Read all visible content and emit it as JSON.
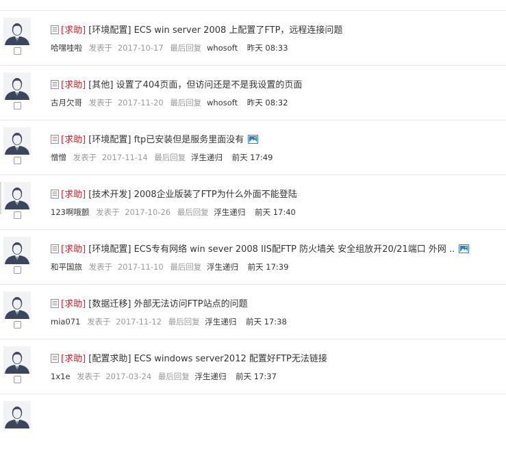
{
  "labels": {
    "posted": "发表于",
    "last_reply": "最后回复",
    "help_tag": "[求助]"
  },
  "topics": [
    {
      "category": "[环境配置]",
      "title": "ECS win server 2008 上配置了FTP，远程连接问题",
      "author": "哈嘿哇啦",
      "date": "2017-10-17",
      "last_user": "whosoft",
      "last_time": "昨天 08:33",
      "has_image": false
    },
    {
      "category": "[其他]",
      "title": "设置了404页面，但访问还是不是我设置的页面",
      "author": "古月欠哥",
      "date": "2017-11-20",
      "last_user": "whosoft",
      "last_time": "昨天 08:32",
      "has_image": false
    },
    {
      "category": "[环境配置]",
      "title": "ftp已安装但是服务里面没有",
      "author": "憎憎",
      "date": "2017-11-14",
      "last_user": "浮生递归",
      "last_time": "前天 17:49",
      "has_image": true
    },
    {
      "category": "[技术开发]",
      "title": "2008企业版装了FTP为什么外面不能登陆",
      "author": "123啊哦颤",
      "date": "2017-10-26",
      "last_user": "浮生递归",
      "last_time": "前天 17:40",
      "has_image": false
    },
    {
      "category": "[环境配置]",
      "title": "ECS专有网络 win sever 2008 IIS配FTP 防火墙关 安全组放开20/21端口 外网 ..",
      "author": "和平国旅",
      "date": "2017-11-10",
      "last_user": "浮生递归",
      "last_time": "前天 17:39",
      "has_image": true
    },
    {
      "category": "[数据迁移]",
      "title": "外部无法访问FTP站点的问题",
      "author": "mia071",
      "date": "2017-11-12",
      "last_user": "浮生递归",
      "last_time": "前天 17:38",
      "has_image": false
    },
    {
      "category": "[配置求助]",
      "title": "ECS windows server2012 配置好FTP无法链接",
      "author": "1x1e",
      "date": "2017-03-24",
      "last_user": "浮生递归",
      "last_time": "前天 17:37",
      "has_image": false
    }
  ],
  "colors": {
    "help_tag": "#d9212b",
    "muted": "#999999",
    "text": "#333333",
    "image_icon": "#2f7fc1",
    "avatar_body": "#3a4660"
  }
}
